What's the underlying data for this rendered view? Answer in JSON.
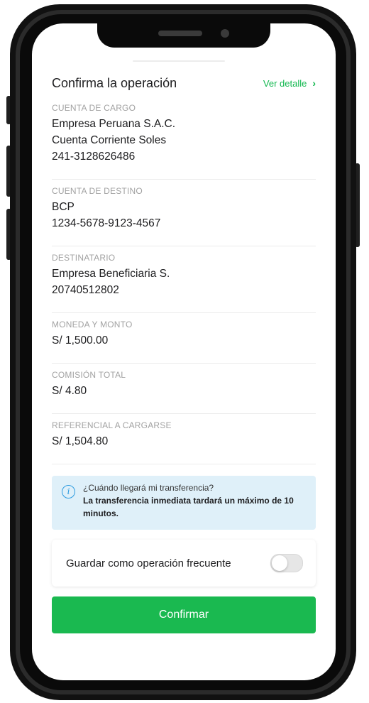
{
  "header": {
    "title": "Confirma la operación",
    "detail_link": "Ver detalle",
    "detail_chevron": "›"
  },
  "sections": [
    {
      "label": "CUENTA DE CARGO",
      "lines": [
        "Empresa Peruana S.A.C.",
        "Cuenta Corriente Soles",
        "241-3128626486"
      ]
    },
    {
      "label": "CUENTA DE DESTINO",
      "lines": [
        "BCP",
        "1234-5678-9123-4567"
      ]
    },
    {
      "label": "DESTINATARIO",
      "lines": [
        "Empresa Beneficiaria S.",
        "20740512802"
      ]
    },
    {
      "label": "MONEDA Y MONTO",
      "lines": [
        "S/ 1,500.00"
      ]
    },
    {
      "label": "COMISIÓN TOTAL",
      "lines": [
        "S/ 4.80"
      ]
    },
    {
      "label": "REFERENCIAL A CARGARSE",
      "lines": [
        "S/ 1,504.80"
      ]
    }
  ],
  "info": {
    "icon": "info-icon",
    "question": "¿Cuándo llegará mi transferencia?",
    "answer": "La transferencia inmediata tardará un máximo de 10 minutos."
  },
  "save": {
    "label": "Guardar como operación frecuente",
    "toggle_on": false
  },
  "confirm_button": "Confirmar",
  "colors": {
    "accent": "#1ab950",
    "info_bg": "#dff0f9",
    "info_icon": "#2c9be0"
  }
}
